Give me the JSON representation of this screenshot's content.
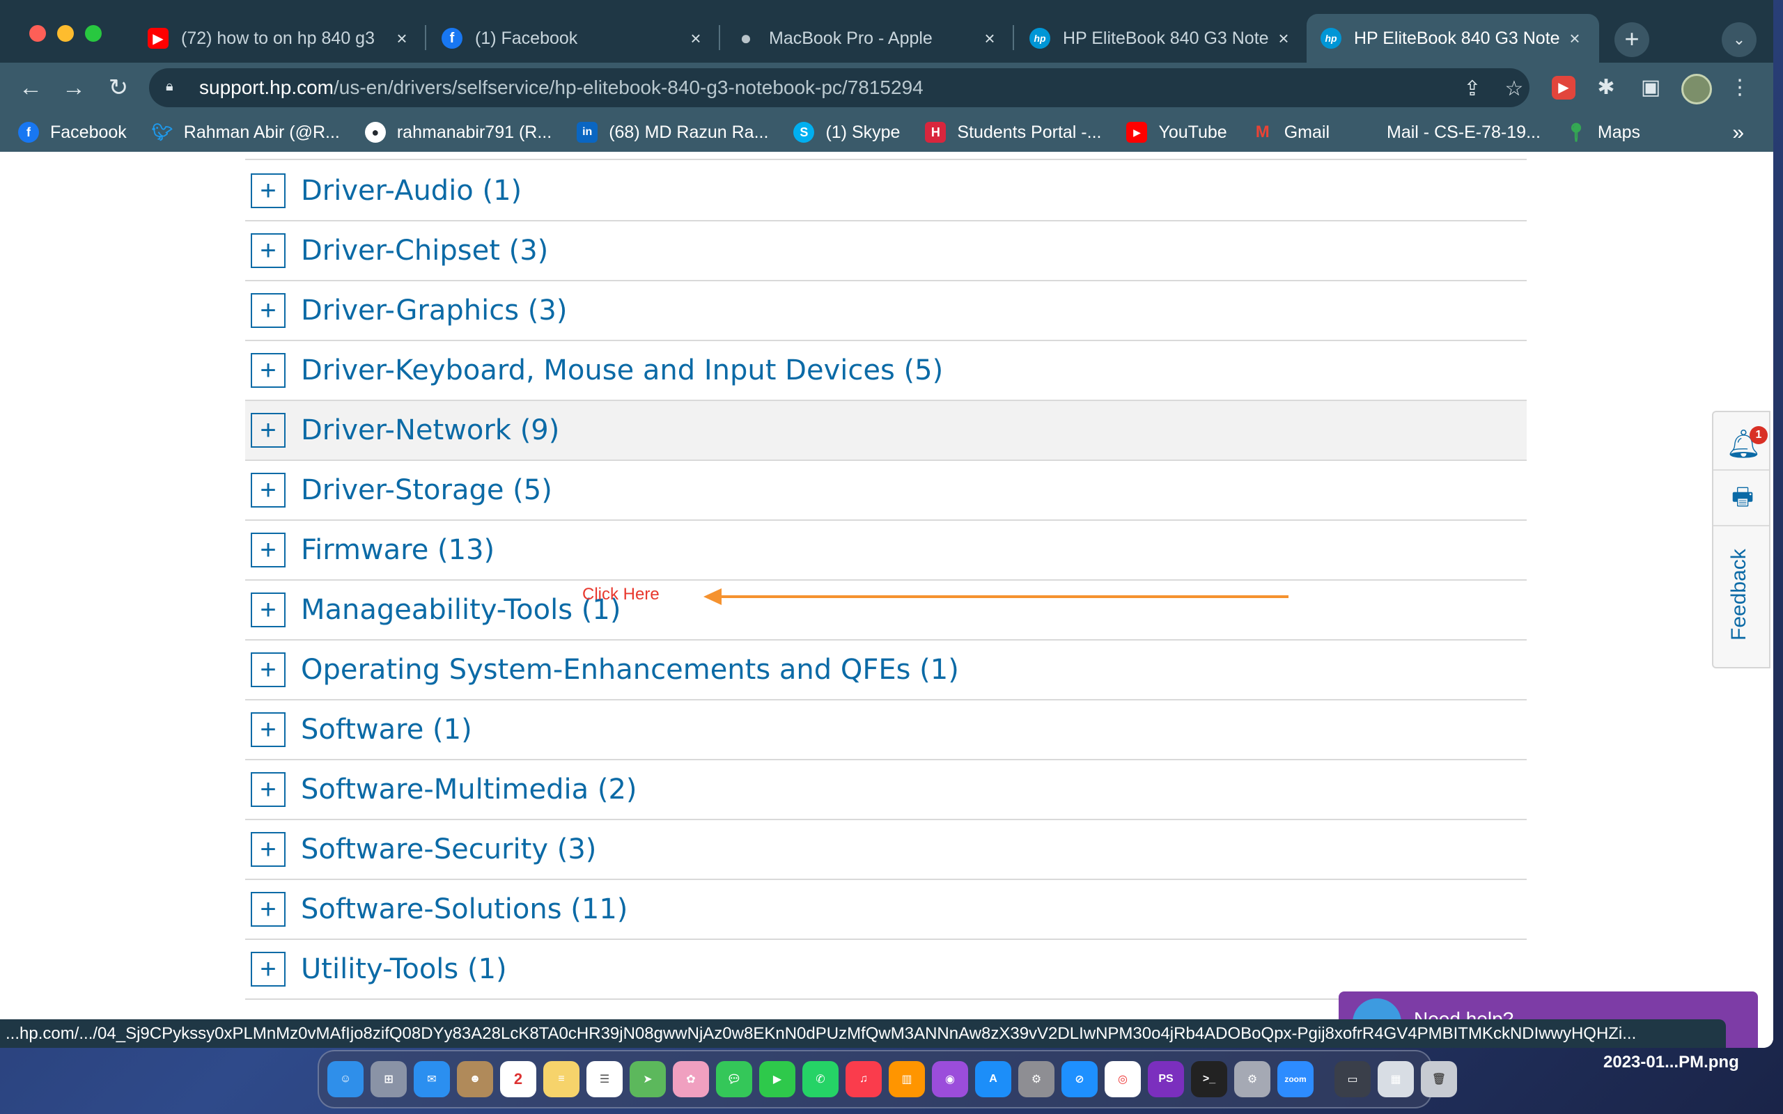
{
  "browser": {
    "tabs": [
      {
        "title": "(72) how to on hp 840 g3",
        "icon": "youtube-icon",
        "color": "#ff0000"
      },
      {
        "title": "(1) Facebook",
        "icon": "facebook-icon",
        "color": "#1877f2"
      },
      {
        "title": "MacBook Pro - Apple",
        "icon": "apple-icon",
        "color": "#9aa5ab"
      },
      {
        "title": "HP EliteBook 840 G3 Note",
        "icon": "hp-icon",
        "color": "#0096d6"
      },
      {
        "title": "HP EliteBook 840 G3 Note",
        "icon": "hp-icon",
        "color": "#0096d6"
      }
    ],
    "active_tab": 4,
    "url_host": "support.hp.com",
    "url_path": "/us-en/drivers/selfservice/hp-elitebook-840-g3-notebook-pc/7815294"
  },
  "bookmarks": [
    {
      "label": "Facebook",
      "icon": "facebook-icon",
      "color": "#1877f2"
    },
    {
      "label": "Rahman Abir (@R...",
      "icon": "twitter-icon",
      "color": "#1d9bf0"
    },
    {
      "label": "rahmanabir791 (R...",
      "icon": "github-icon",
      "color": "#24292f"
    },
    {
      "label": "(68) MD Razun Ra...",
      "icon": "linkedin-icon",
      "color": "#0a66c2"
    },
    {
      "label": "(1) Skype",
      "icon": "skype-icon",
      "color": "#00aff0"
    },
    {
      "label": "Students Portal -...",
      "icon": "portal-icon",
      "color": "#d9263d"
    },
    {
      "label": "YouTube",
      "icon": "youtube-icon",
      "color": "#ff0000"
    },
    {
      "label": "Gmail",
      "icon": "gmail-icon",
      "color": "#ea4335"
    },
    {
      "label": "Mail - CS-E-78-19...",
      "icon": "microsoft-icon",
      "color": "#f25022"
    },
    {
      "label": "Maps",
      "icon": "maps-icon",
      "color": "#34a853"
    }
  ],
  "driver_categories": [
    "Driver-Audio (1)",
    "Driver-Chipset (3)",
    "Driver-Graphics (3)",
    "Driver-Keyboard, Mouse and Input Devices (5)",
    "Driver-Network (9)",
    "Driver-Storage (5)",
    "Firmware (13)",
    "Manageability-Tools (1)",
    "Operating System-Enhancements and QFEs (1)",
    "Software (1)",
    "Software-Multimedia (2)",
    "Software-Security (3)",
    "Software-Solutions (11)",
    "Utility-Tools (1)"
  ],
  "annotation": {
    "text": "Click Here",
    "color": "#e8382e",
    "arrow_color": "#f5922f"
  },
  "side_panel": {
    "notification_count": "1",
    "feedback_label": "Feedback"
  },
  "chat_widget": {
    "label": "Need help?"
  },
  "status_url": "...hp.com/.../04_Sj9CPykssy0xPLMnMz0vMAfIjo8zifQ08DYy83A28LcK8TA0cHR39jN08gwwNjAz0w8EKnN0dPUzMfQwM3ANNnAw8zX39vV2DLIwNPM30o4jRb4ADOBoQpx-Pgij8xofrR4GV4PMBITMKckNDIwwyHQHZi...",
  "desktop": {
    "filename": "2023-01...PM.png",
    "dock_date": "2"
  },
  "colors": {
    "accent": "#0b6aa6",
    "chrome_dark": "#1f3745",
    "chrome_toolbar": "#3a5a6a"
  }
}
